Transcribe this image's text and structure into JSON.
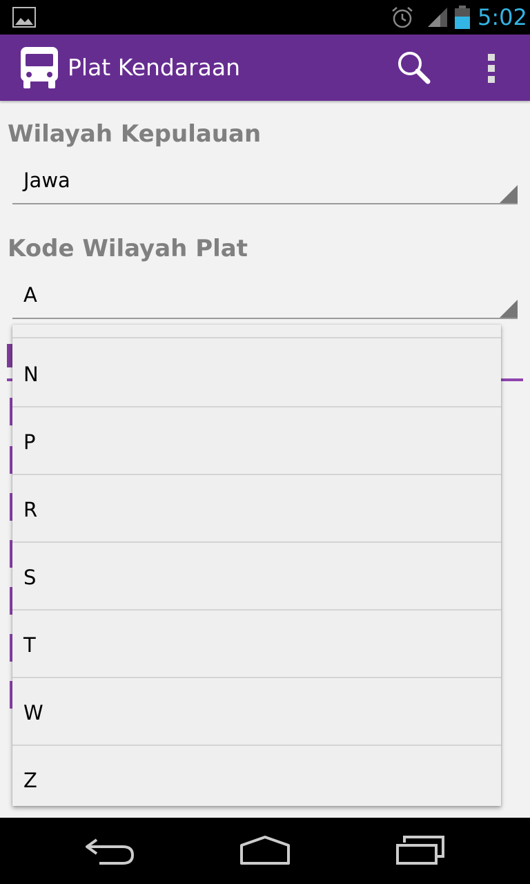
{
  "status_bar": {
    "time": "5:02",
    "icons": [
      "gallery-icon",
      "alarm-icon",
      "signal-icon",
      "battery-icon"
    ]
  },
  "action_bar": {
    "title": "Plat Kendaraan",
    "app_icon": "bus-icon",
    "actions": [
      "search-icon",
      "overflow-menu-icon"
    ]
  },
  "form": {
    "region_label": "Wilayah Kepulauan",
    "region_value": "Jawa",
    "plate_code_label": "Kode Wilayah Plat",
    "plate_code_value": "A"
  },
  "dropdown": {
    "options": [
      "N",
      "P",
      "R",
      "S",
      "T",
      "W",
      "Z"
    ]
  },
  "colors": {
    "accent": "#662d91",
    "status_time": "#33b5e5",
    "label_gray": "#808080"
  }
}
